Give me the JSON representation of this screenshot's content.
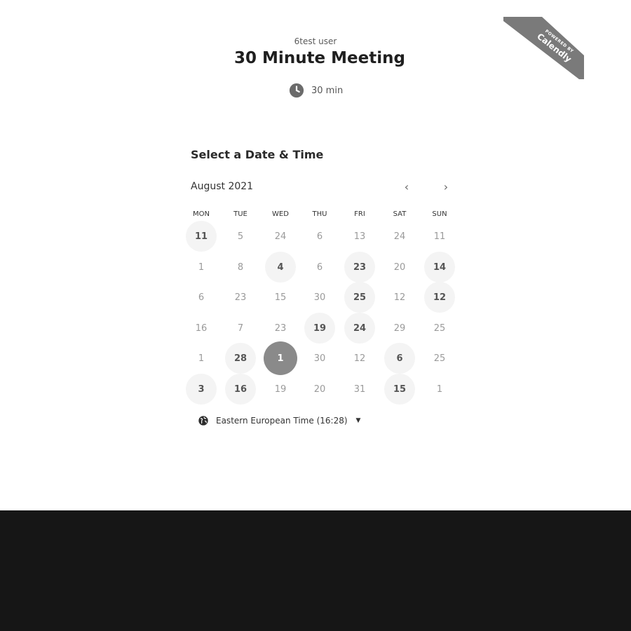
{
  "host_name": "6test user",
  "event_title": "30 Minute Meeting",
  "duration": "30 min",
  "badge": {
    "small": "POWERED BY",
    "brand": "Calendly"
  },
  "section_title": "Select a Date & Time",
  "month_label": "August 2021",
  "weekdays": [
    "MON",
    "TUE",
    "WED",
    "THU",
    "FRI",
    "SAT",
    "SUN"
  ],
  "weeks": [
    [
      "11",
      "5",
      "24",
      "6",
      "13",
      "24",
      "11"
    ],
    [
      "1",
      "8",
      "4",
      "6",
      "23",
      "20",
      "14"
    ],
    [
      "6",
      "23",
      "15",
      "30",
      "25",
      "12",
      "12"
    ],
    [
      "16",
      "7",
      "23",
      "19",
      "24",
      "29",
      "25"
    ],
    [
      "1",
      "28",
      "1",
      "30",
      "12",
      "6",
      "25"
    ],
    [
      "3",
      "16",
      "19",
      "20",
      "31",
      "15",
      "1"
    ]
  ],
  "available": [
    [
      0,
      0
    ],
    [
      1,
      2
    ],
    [
      1,
      4
    ],
    [
      1,
      6
    ],
    [
      2,
      4
    ],
    [
      2,
      6
    ],
    [
      3,
      3
    ],
    [
      3,
      4
    ],
    [
      4,
      1
    ],
    [
      4,
      5
    ],
    [
      5,
      0
    ],
    [
      5,
      1
    ],
    [
      5,
      5
    ]
  ],
  "selected": [
    4,
    2
  ],
  "timezone": "Eastern European Time (16:28)"
}
